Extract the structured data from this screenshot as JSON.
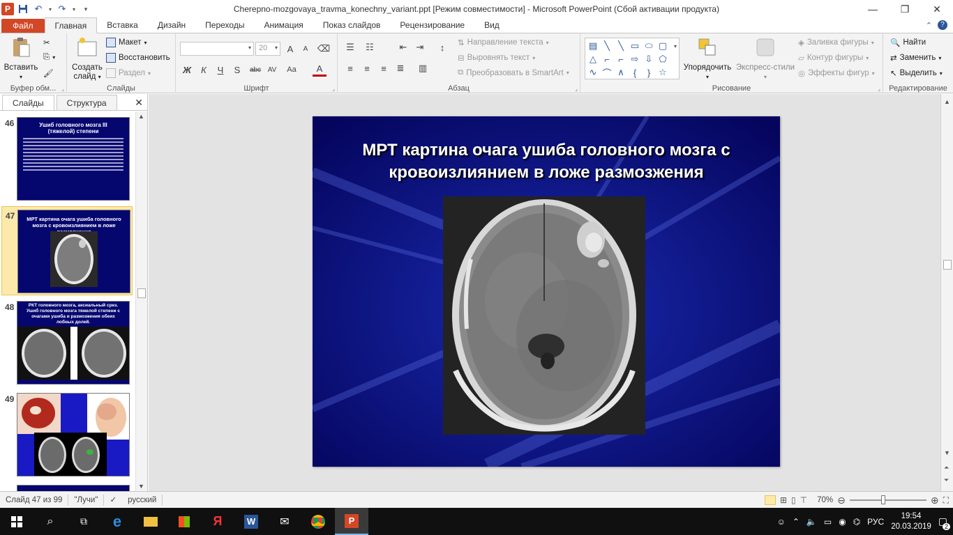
{
  "window": {
    "title": "Cherepno-mozgovaya_travma_konechny_variant.ppt [Режим совместимости]  -  Microsoft PowerPoint (Сбой активации продукта)"
  },
  "ribbon_tabs": [
    "Файл",
    "Главная",
    "Вставка",
    "Дизайн",
    "Переходы",
    "Анимация",
    "Показ слайдов",
    "Рецензирование",
    "Вид"
  ],
  "ribbon": {
    "clipboard": {
      "paste": "Вставить",
      "label": "Буфер обм..."
    },
    "slides": {
      "new_slide": "Создать слайд",
      "layout": "Макет",
      "reset": "Восстановить",
      "section": "Раздел",
      "label": "Слайды"
    },
    "font": {
      "font_name": "",
      "font_size": "20",
      "bold": "Ж",
      "italic": "К",
      "underline": "Ч",
      "strike": "abc",
      "shadow": "S",
      "spacing": "AV",
      "case": "Aa",
      "color": "A",
      "grow": "A",
      "shrink": "A",
      "label": "Шрифт"
    },
    "paragraph": {
      "text_direction": "Направление текста",
      "align_text": "Выровнять текст",
      "smartart": "Преобразовать в SmartArt",
      "label": "Абзац"
    },
    "drawing": {
      "arrange": "Упорядочить",
      "quick_styles": "Экспресс-стили",
      "fill": "Заливка фигуры",
      "outline": "Контур фигуры",
      "effects": "Эффекты фигур",
      "label": "Рисование"
    },
    "editing": {
      "find": "Найти",
      "replace": "Заменить",
      "select": "Выделить",
      "label": "Редактирование"
    }
  },
  "left_panel": {
    "tabs": [
      "Слайды",
      "Структура"
    ],
    "thumbnails": [
      {
        "number": "46",
        "title": "Ушиб головного мозга III (тяжелой) степени"
      },
      {
        "number": "47",
        "title": "МРТ картина очага ушиба головного мозга с кровоизлиянием в ложе размозжения",
        "selected": true
      },
      {
        "number": "48",
        "title": "РКТ головного мозга, аксиальный срез. Ушиб головного мозга тяжелой степени с очагами ушиба и размозжения обеих лобных долей."
      },
      {
        "number": "49",
        "title": ""
      }
    ]
  },
  "slide": {
    "title": "МРТ картина очага ушиба головного мозга с кровоизлиянием в ложе размозжения",
    "background_color": "#06066b"
  },
  "status_bar": {
    "slide_position": "Слайд 47 из 99",
    "theme": "\"Лучи\"",
    "language": "русский",
    "zoom": "70%"
  },
  "taskbar": {
    "time": "19:54",
    "date": "20.03.2019",
    "language": "РУС",
    "notifications": "2"
  }
}
